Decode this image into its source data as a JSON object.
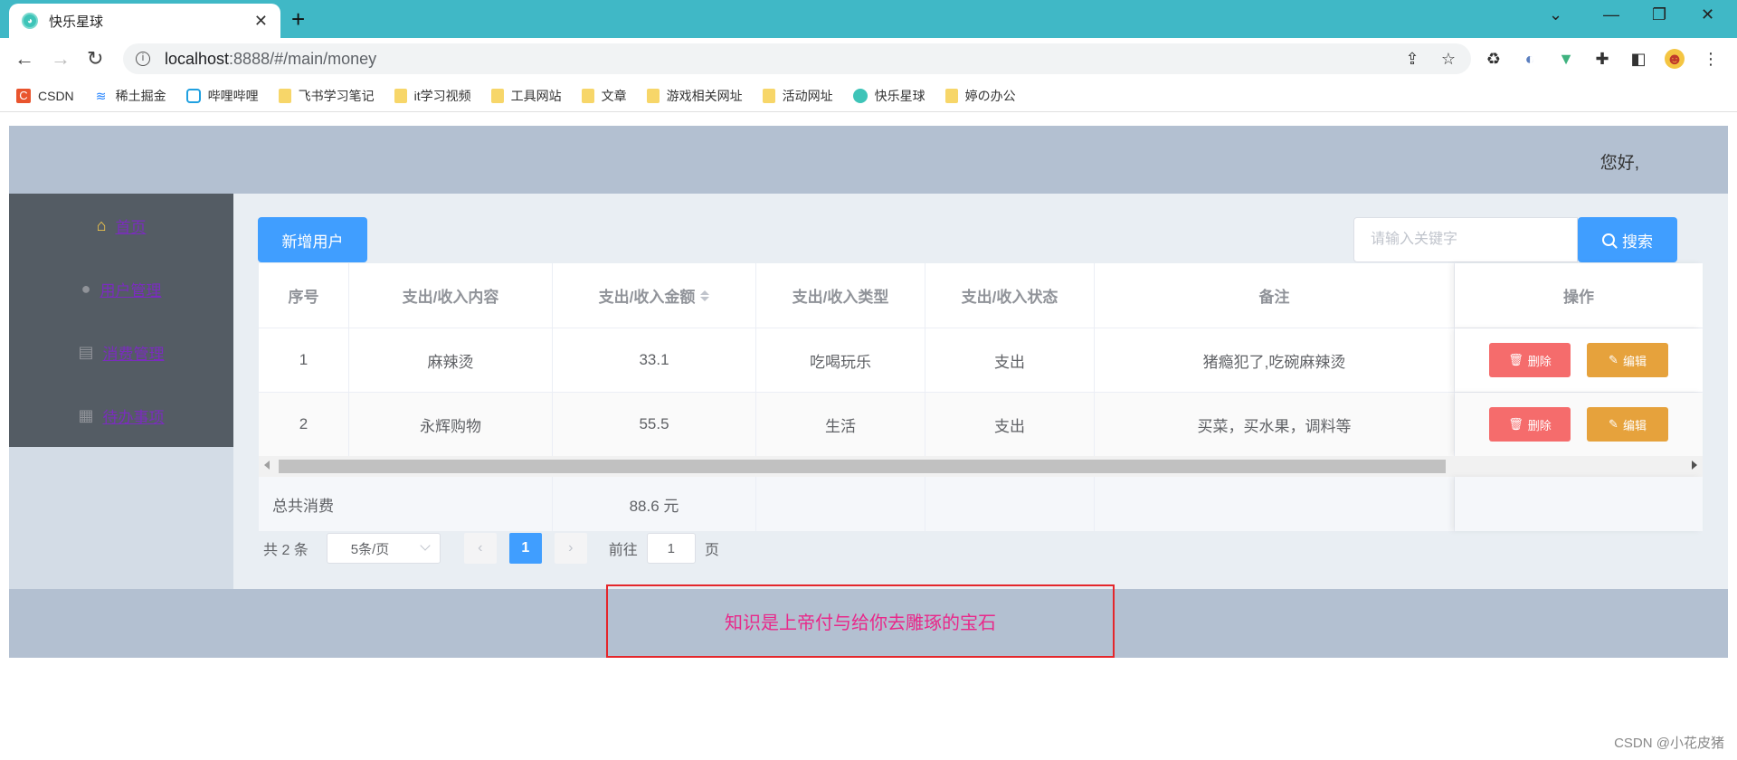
{
  "browser": {
    "tab_title": "快乐星球",
    "url_host": "localhost",
    "url_rest": ":8888/#/main/money",
    "bookmarks": [
      {
        "label": "CSDN",
        "icon": "csdn-icon"
      },
      {
        "label": "稀土掘金",
        "icon": "juejin-icon"
      },
      {
        "label": "哔哩哔哩",
        "icon": "bilibili-icon"
      },
      {
        "label": "飞书学习笔记",
        "icon": "folder-icon"
      },
      {
        "label": "it学习视频",
        "icon": "folder-icon"
      },
      {
        "label": "工具网站",
        "icon": "folder-icon"
      },
      {
        "label": "文章",
        "icon": "folder-icon"
      },
      {
        "label": "游戏相关网址",
        "icon": "folder-icon"
      },
      {
        "label": "活动网址",
        "icon": "folder-icon"
      },
      {
        "label": "快乐星球",
        "icon": "planet-icon"
      },
      {
        "label": "婷の办公",
        "icon": "folder-icon"
      }
    ]
  },
  "header": {
    "greeting": "您好,"
  },
  "sidebar": {
    "items": [
      {
        "label": "首页",
        "icon": "home-icon"
      },
      {
        "label": "用户管理",
        "icon": "user-icon"
      },
      {
        "label": "消费管理",
        "icon": "document-icon"
      },
      {
        "label": "待办事项",
        "icon": "grid-icon"
      }
    ]
  },
  "toolbar": {
    "add_label": "新增用户",
    "search_placeholder": "请输入关键字",
    "search_label": "搜索"
  },
  "table": {
    "columns": [
      "序号",
      "支出/收入内容",
      "支出/收入金额",
      "支出/收入类型",
      "支出/收入状态",
      "备注",
      "操作"
    ],
    "rows": [
      {
        "index": "1",
        "content": "麻辣烫",
        "amount": "33.1",
        "type": "吃喝玩乐",
        "status": "支出",
        "note": "猪瘾犯了,吃碗麻辣烫"
      },
      {
        "index": "2",
        "content": "永辉购物",
        "amount": "55.5",
        "type": "生活",
        "status": "支出",
        "note": "买菜，买水果，调料等"
      }
    ],
    "delete_label": "删除",
    "edit_label": "编辑",
    "summary_label": "总共消费",
    "summary_value": "88.6 元"
  },
  "pagination": {
    "total": "共 2 条",
    "page_size": "5条/页",
    "current_page": "1",
    "goto_prefix": "前往",
    "goto_value": "1",
    "goto_suffix": "页"
  },
  "footer": {
    "motto": "知识是上帝付与给你去雕琢的宝石"
  },
  "watermark": "CSDN @小花皮猪",
  "colors": {
    "primary": "#409eff",
    "danger": "#f56c6c",
    "warning": "#e6a23c",
    "sidebar_bg": "#545c64",
    "header_bg": "#b3c0d1",
    "tab_bar": "#40b8c6"
  }
}
